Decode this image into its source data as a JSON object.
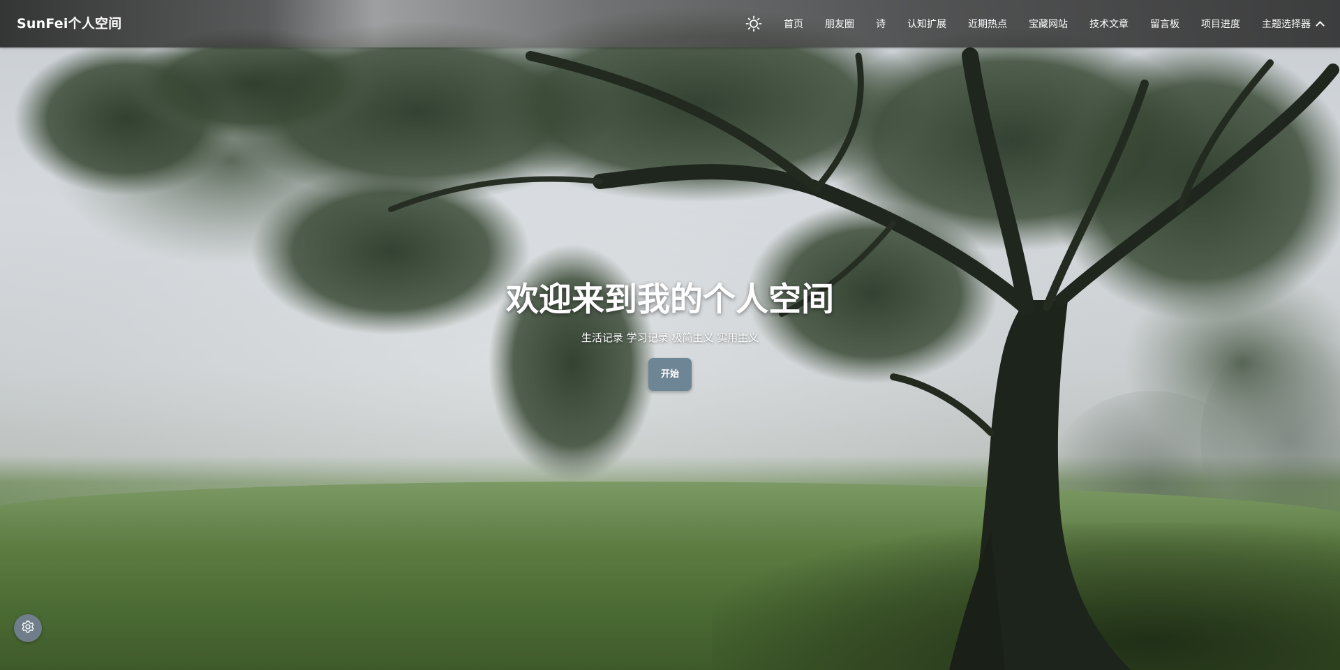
{
  "colors": {
    "navbar": "#3c3c3c",
    "accent_button": "#6e8595",
    "settings_fab": "#6f7e8a",
    "text": "#ffffff"
  },
  "navbar": {
    "brand": "SunFei个人空间",
    "theme_icon": "sun-icon",
    "items": [
      "首页",
      "朋友圈",
      "诗",
      "认知扩展",
      "近期热点",
      "宝藏网站",
      "技术文章",
      "留言板",
      "项目进度"
    ],
    "dropdown_label": "主题选择器",
    "dropdown_icon": "chevron-up-icon"
  },
  "hero": {
    "title": "欢迎来到我的个人空间",
    "subtitle": "生活记录 学习记录 极简主义 实用主义",
    "button_label": "开始"
  },
  "settings": {
    "icon": "gear-icon"
  }
}
